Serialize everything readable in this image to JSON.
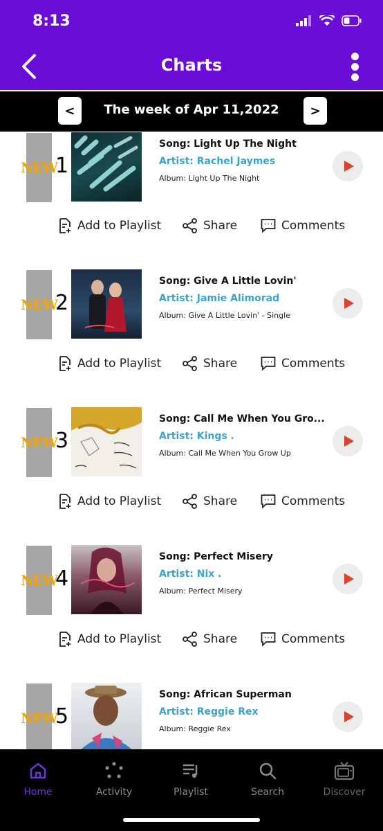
{
  "status": {
    "time": "8:13"
  },
  "header": {
    "title": "Charts"
  },
  "week": {
    "label": "The week of Apr 11,2022",
    "prev": "<",
    "next": ">"
  },
  "badge": "NEW",
  "actions": {
    "add": "Add to Playlist",
    "share": "Share",
    "comments": "Comments"
  },
  "items": [
    {
      "rank": "1",
      "song": "Song: Light Up The Night",
      "artist": "Artist: Rachel Jaymes",
      "album": "Album: Light Up The Night"
    },
    {
      "rank": "2",
      "song": "Song: Give A Little Lovin'",
      "artist": "Artist: Jamie Alimorad",
      "album": "Album: Give A Little Lovin' - Single"
    },
    {
      "rank": "3",
      "song": "Song: Call Me When You Gro...",
      "artist": "Artist: Kings .",
      "album": "Album: Call Me When You Grow Up"
    },
    {
      "rank": "4",
      "song": "Song: Perfect Misery",
      "artist": "Artist: Nix .",
      "album": "Album: Perfect Misery"
    },
    {
      "rank": "5",
      "song": "Song: African Superman",
      "artist": "Artist: Reggie Rex",
      "album": "Album: Reggie Rex"
    }
  ],
  "tabs": [
    {
      "label": "Home"
    },
    {
      "label": "Activity"
    },
    {
      "label": "Playlist"
    },
    {
      "label": "Search"
    },
    {
      "label": "Discover"
    }
  ],
  "colors": {
    "brand": "#6a0dd6",
    "artist": "#3aa3d0",
    "badge_text": "#f2a400",
    "play": "#d9432f"
  }
}
